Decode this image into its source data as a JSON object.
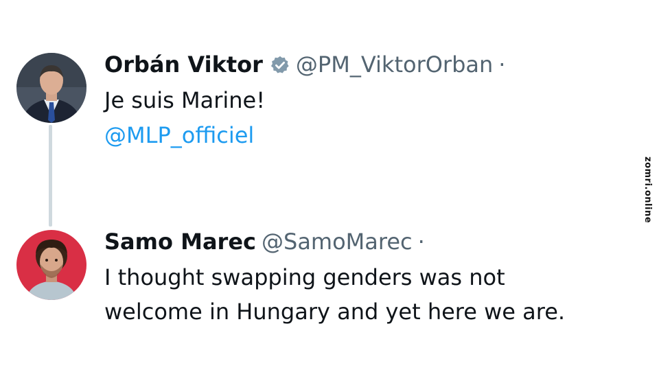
{
  "tweet1": {
    "display_name": "Orbán Viktor",
    "handle": "@PM_ViktorOrban",
    "separator": "·",
    "text": "Je suis Marine!",
    "mention": "@MLP_officiel",
    "verified_icon": "verified-badge-icon"
  },
  "tweet2": {
    "display_name": "Samo Marec",
    "handle": "@SamoMarec",
    "separator": "·",
    "text_line1": "I thought swapping genders was not",
    "text_line2": "welcome in Hungary and yet here we are."
  },
  "watermark": "zomri.online",
  "colors": {
    "name": "#0f1419",
    "handle": "#536471",
    "mention": "#1d9bf0",
    "thread_line": "#cfd9de"
  }
}
